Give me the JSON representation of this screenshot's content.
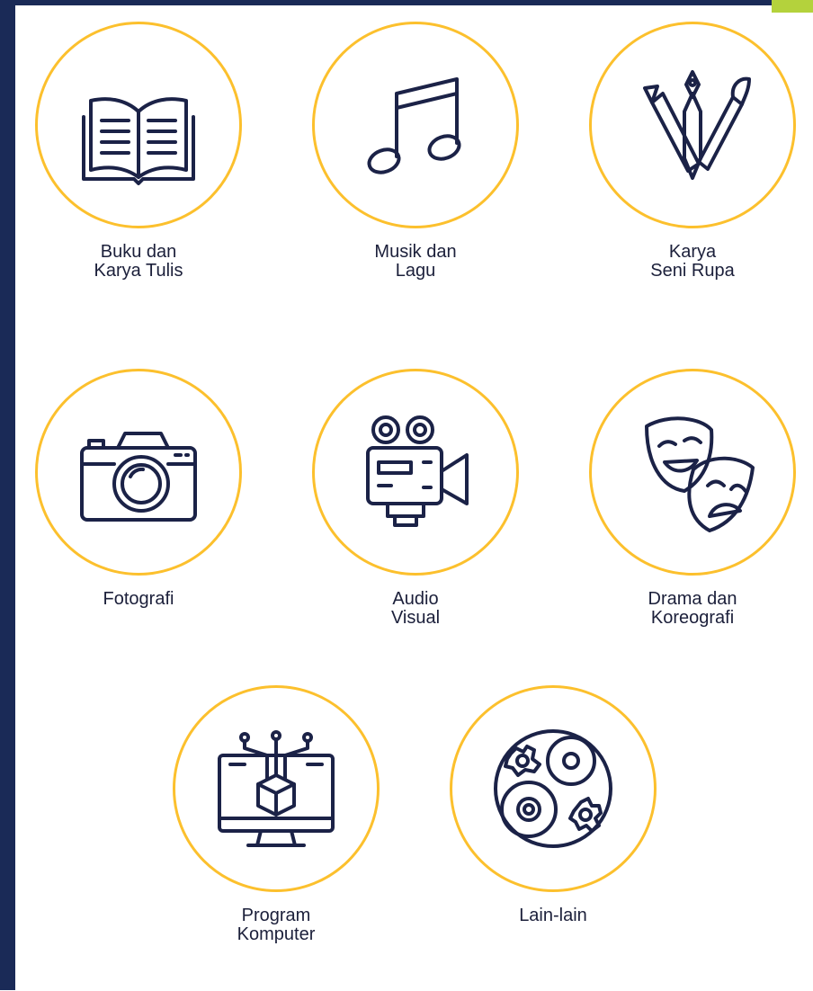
{
  "accent_colors": {
    "navy": "#1a2a57",
    "circle_border": "#fcc02d",
    "corner": "#b4d23c",
    "icon_stroke": "#1b2247"
  },
  "categories": [
    {
      "icon": "open-book-icon",
      "label_lines": [
        "Buku dan",
        "Karya Tulis"
      ]
    },
    {
      "icon": "music-note-icon",
      "label_lines": [
        "Musik dan",
        "Lagu"
      ]
    },
    {
      "icon": "art-tools-icon",
      "label_lines": [
        "Karya",
        "Seni Rupa"
      ]
    },
    {
      "icon": "camera-icon",
      "label_lines": [
        "Fotografi"
      ]
    },
    {
      "icon": "film-camera-icon",
      "label_lines": [
        "Audio",
        "Visual"
      ]
    },
    {
      "icon": "theater-masks-icon",
      "label_lines": [
        "Drama dan",
        "Koreografi"
      ]
    },
    {
      "icon": "computer-program-icon",
      "label_lines": [
        "Program",
        "Komputer"
      ]
    },
    {
      "icon": "misc-disc-icon",
      "label_lines": [
        "Lain-lain"
      ]
    }
  ]
}
